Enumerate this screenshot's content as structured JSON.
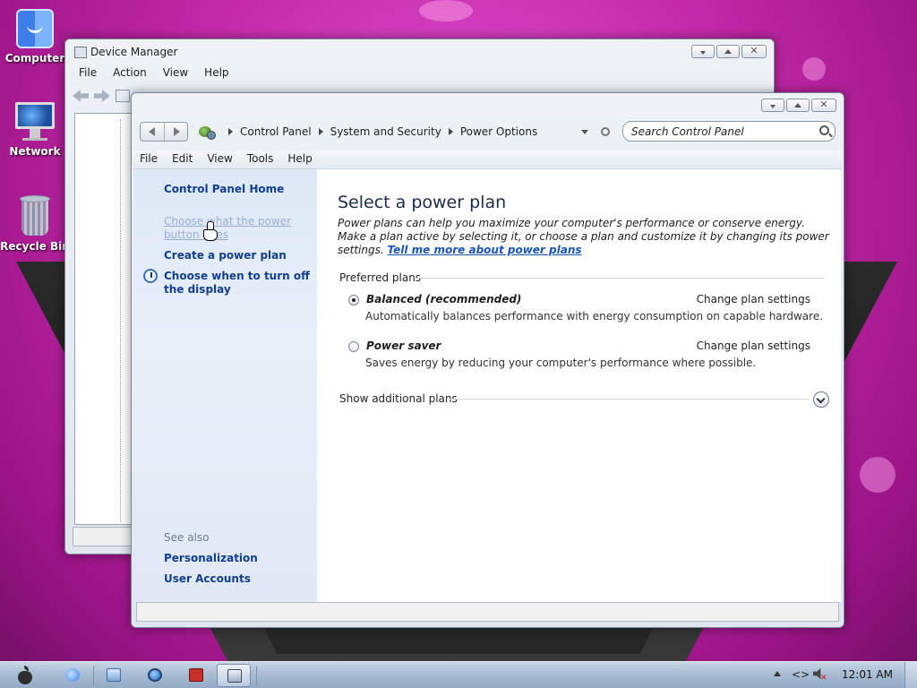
{
  "desktop": {
    "icons": [
      {
        "label": "Computer"
      },
      {
        "label": "Network"
      },
      {
        "label": "Recycle Bin"
      }
    ]
  },
  "device_manager": {
    "title": "Device Manager",
    "menu": [
      "File",
      "Action",
      "View",
      "Help"
    ]
  },
  "power_window": {
    "breadcrumb": [
      "Control Panel",
      "System and Security",
      "Power Options"
    ],
    "search_placeholder": "Search Control Panel",
    "menu": [
      "File",
      "Edit",
      "View",
      "Tools",
      "Help"
    ],
    "sidebar": {
      "home": "Control Panel Home",
      "choose_power_button": "Choose what the power button does",
      "create_plan": "Create a power plan",
      "turn_off_display": "Choose when to turn off the display",
      "see_also": "See also",
      "personalization": "Personalization",
      "user_accounts": "User Accounts"
    },
    "content": {
      "title": "Select a power plan",
      "description": "Power plans can help you maximize your computer's performance or conserve energy. Make a plan active by selecting it, or choose a plan and customize it by changing its power settings.",
      "learn_more": "Tell me more about power plans",
      "preferred_label": "Preferred plans",
      "plans": [
        {
          "name": "Balanced (recommended)",
          "description": "Automatically balances performance with energy consumption on capable hardware.",
          "action": "Change plan settings",
          "selected": true
        },
        {
          "name": "Power saver",
          "description": "Saves energy by reducing your computer's performance where possible.",
          "action": "Change plan settings",
          "selected": false
        }
      ],
      "show_additional": "Show additional plans"
    }
  },
  "taskbar": {
    "clock": "12:01 AM"
  },
  "colors": {
    "link": "#123e8f",
    "disabled_link": "#9aaed0",
    "desktop_bg": "#c42aa8"
  }
}
